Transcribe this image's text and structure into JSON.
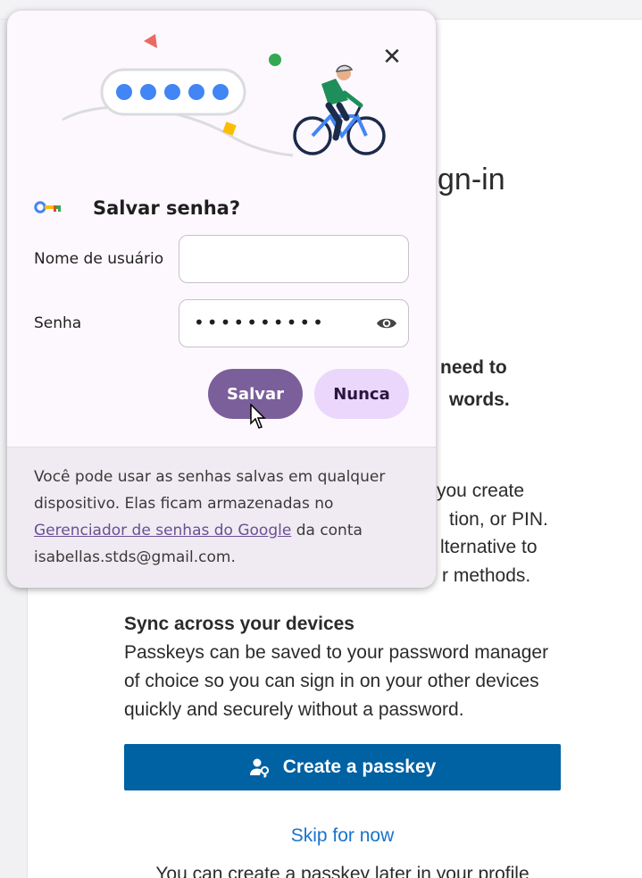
{
  "page": {
    "title_fragment": "gn-in",
    "heading_lines": [
      " need to",
      "words."
    ],
    "body_lines": [
      "you create",
      "tion, or PIN.",
      "lternative to",
      "r methods."
    ],
    "sync_heading": "Sync across your devices",
    "sync_lines": [
      "Passkeys can be saved to your password manager",
      "of choice so you can sign in on your other devices",
      "quickly and securely without a password."
    ],
    "create_button": "Create a passkey",
    "skip_link": "Skip for now",
    "later_text": "You can create a passkey later in your profile"
  },
  "dialog": {
    "title": "Salvar senha?",
    "username_label": "Nome de usuário",
    "username_value": "",
    "password_label": "Senha",
    "password_value": "••••••••••",
    "save_button": "Salvar",
    "never_button": "Nunca",
    "footer_prefix": "Você pode usar as senhas salvas em qualquer dispositivo. Elas ficam armazenadas no ",
    "footer_link": "Gerenciador de senhas do Google",
    "footer_suffix": " da conta isabellas.stds@gmail.com."
  },
  "icons": [
    "close-icon",
    "key-icon",
    "eye-icon",
    "passkey-user-icon",
    "mouse-cursor-icon"
  ],
  "colors": {
    "primary_button": "#7b5f9a",
    "secondary_button": "#ead7fb",
    "cta": "#0061a3",
    "link": "#1a73c8"
  }
}
